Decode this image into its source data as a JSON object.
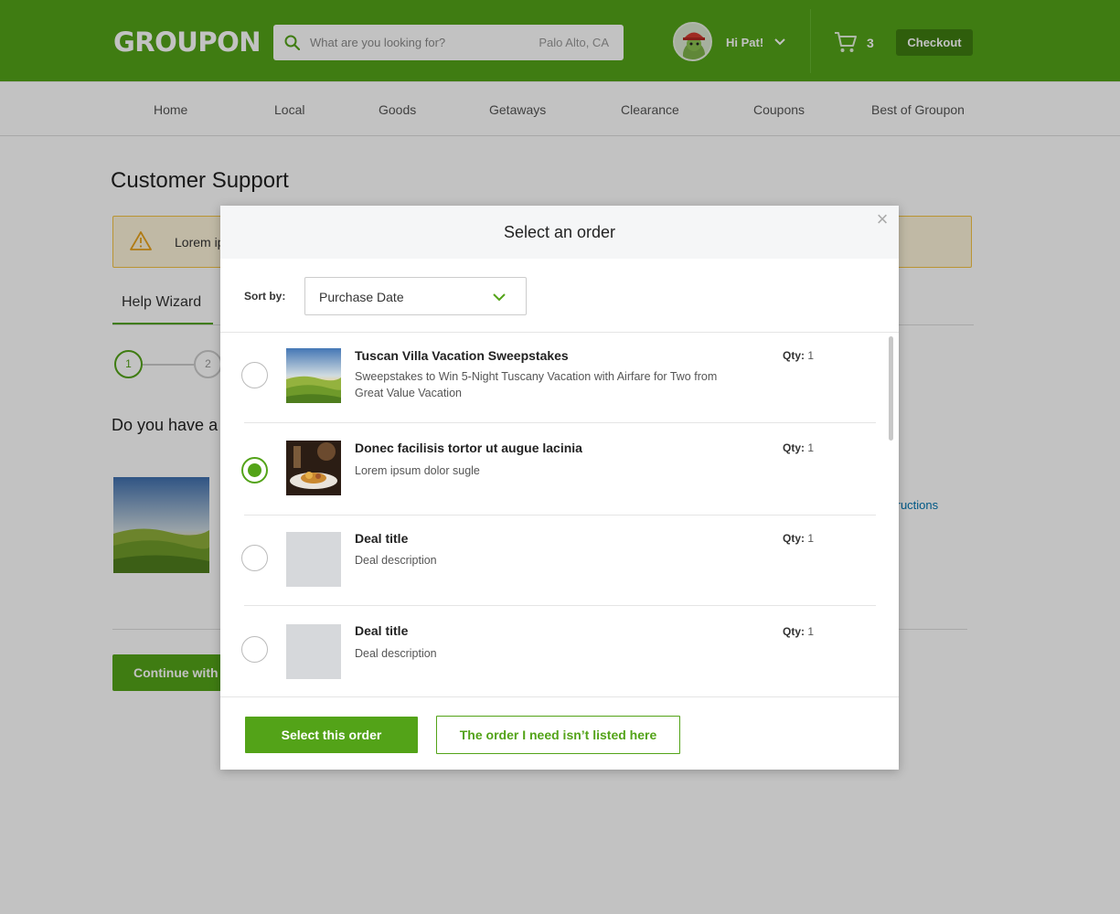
{
  "header": {
    "logo_text": "GROUPON",
    "search_placeholder": "What are you looking for?",
    "search_location": "Palo Alto, CA",
    "greeting": "Hi Pat!",
    "cart_count": "3",
    "checkout_label": "Checkout"
  },
  "nav": {
    "items": [
      "Home",
      "Local",
      "Goods",
      "Getaways",
      "Clearance",
      "Coupons",
      "Best of Groupon"
    ]
  },
  "page": {
    "title": "Customer Support",
    "alert_text": "Lorem ip",
    "wizard_tab": "Help Wizard",
    "steps": [
      "1",
      "2"
    ],
    "question": "Do you have a",
    "link_fragment": "tructions",
    "continue_label": "Continue with"
  },
  "modal": {
    "title": "Select an order",
    "close_icon": "×",
    "sort_label": "Sort by:",
    "sort_value": "Purchase Date",
    "qty_label": "Qty:",
    "orders": [
      {
        "title": "Tuscan Villa Vacation Sweepstakes",
        "description": "Sweepstakes to Win 5-Night Tuscany Vacation with Airfare for Two from Great Value Vacation",
        "qty": "1",
        "selected": false,
        "thumb": "landscape-image"
      },
      {
        "title": "Donec facilisis tortor ut augue lacinia",
        "description": "Lorem ipsum dolor sugle",
        "qty": "1",
        "selected": true,
        "thumb": "dish-image"
      },
      {
        "title": "Deal title",
        "description": "Deal description",
        "qty": "1",
        "selected": false,
        "thumb": "placeholder"
      },
      {
        "title": "Deal title",
        "description": "Deal description",
        "qty": "1",
        "selected": false,
        "thumb": "placeholder"
      }
    ],
    "select_button": "Select this order",
    "not_listed_button": "The order I need isn’t listed here"
  },
  "colors": {
    "brand_green": "#53a318",
    "dark_green": "#3f7c10",
    "alert_bg": "#fdf3d9",
    "alert_border": "#f5c342",
    "link_blue": "#0074b0"
  },
  "icons": [
    "search-icon",
    "avatar",
    "chevron-down-icon",
    "cart-icon",
    "warning-icon",
    "close-icon"
  ]
}
